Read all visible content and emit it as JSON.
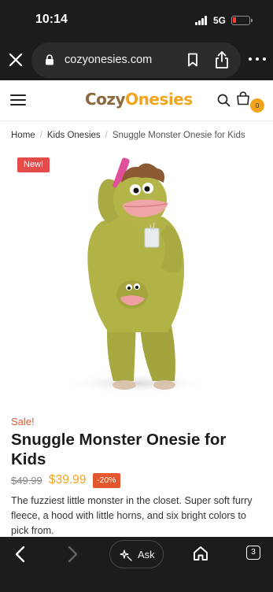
{
  "status_bar": {
    "time": "10:14",
    "network": "5G"
  },
  "browser": {
    "url": "cozyonesies.com",
    "open_tabs": "3",
    "ask_label": "Ask"
  },
  "site": {
    "logo_part1": "Cozy",
    "logo_part2": "Onesies",
    "cart_count": "0",
    "brand_brown": "#8a6a3d",
    "brand_yellow": "#f2a51c"
  },
  "breadcrumb": {
    "home": "Home",
    "category": "Kids Onesies",
    "current": "Snuggle Monster Onesie for Kids"
  },
  "product": {
    "badge": "New!",
    "sale_label": "Sale!",
    "title": "Snuggle Monster Onesie for Kids",
    "old_price": "$49.99",
    "price": "$39.99",
    "discount": "-20%",
    "description": "The fuzziest little monster in the closet. Super soft furry fleece, a hood with little horns, and six bright colors to pick from.",
    "image_alt": "green-monster-onesie-photo"
  },
  "icons": {
    "close": "close-icon",
    "lock": "lock-icon",
    "bookmark": "bookmark-icon",
    "share": "share-icon",
    "more": "more-icon",
    "menu": "hamburger-icon",
    "search": "search-icon",
    "cart": "cart-icon",
    "back": "back-icon",
    "forward": "forward-icon",
    "ask": "sparkle-icon",
    "home": "home-icon",
    "tabs": "tabs-icon"
  }
}
